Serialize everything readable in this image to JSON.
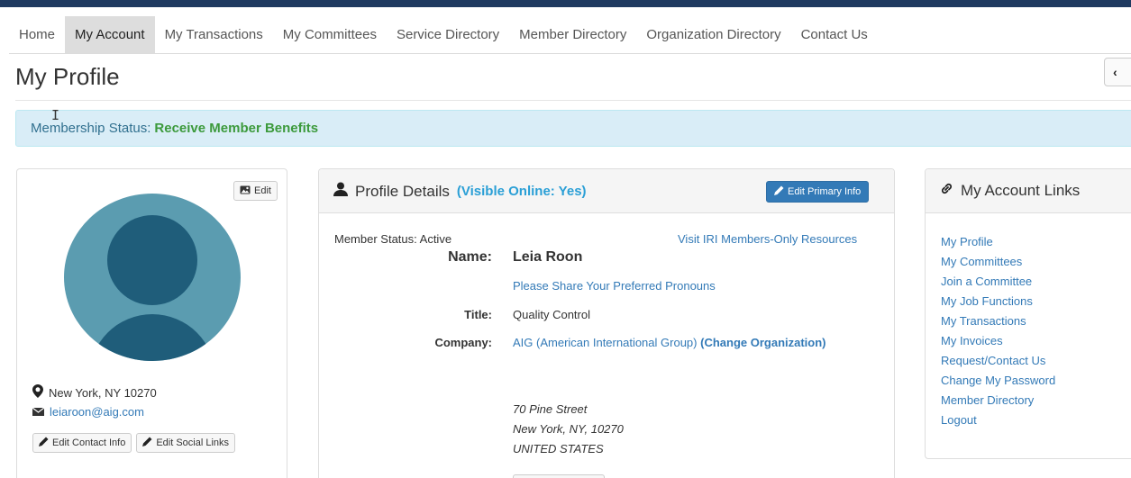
{
  "nav": {
    "items": [
      {
        "label": "Home",
        "active": false
      },
      {
        "label": "My Account",
        "active": true
      },
      {
        "label": "My Transactions",
        "active": false
      },
      {
        "label": "My Committees",
        "active": false
      },
      {
        "label": "Service Directory",
        "active": false
      },
      {
        "label": "Member Directory",
        "active": false
      },
      {
        "label": "Organization Directory",
        "active": false
      },
      {
        "label": "Contact Us",
        "active": false
      }
    ]
  },
  "page": {
    "title": "My Profile",
    "collapse_icon": "‹"
  },
  "alert": {
    "label": "Membership Status:",
    "value": "Receive Member Benefits"
  },
  "left_panel": {
    "edit_photo_label": "Edit",
    "location": "New York, NY 10270",
    "email": "leiaroon@aig.com",
    "edit_contact_label": "Edit Contact Info",
    "edit_social_label": "Edit Social Links"
  },
  "profile": {
    "heading": "Profile Details",
    "visibility": "(Visible Online: Yes)",
    "edit_primary_label": "Edit Primary Info",
    "member_status": "Member Status: Active",
    "resources_link": "Visit IRI Members-Only Resources",
    "name_label": "Name:",
    "name_value": "Leia Roon",
    "pronouns_link": "Please Share Your Preferred Pronouns",
    "title_label": "Title:",
    "title_value": "Quality Control",
    "company_label": "Company:",
    "company_value": "AIG (American International Group)",
    "change_org_link": "(Change Organization)",
    "address_line1": "70 Pine Street",
    "address_line2": "New York, NY, 10270",
    "address_line3": "UNITED STATES"
  },
  "account_links": {
    "heading": "My Account Links",
    "items": [
      "My Profile",
      "My Committees",
      "Join a Committee",
      "My Job Functions",
      "My Transactions",
      "My Invoices",
      "Request/Contact Us",
      "Change My Password",
      "Member Directory",
      "Logout"
    ]
  },
  "colors": {
    "accent": "#337ab7",
    "alert_bg": "#d9edf7",
    "status_green": "#3c9a3c",
    "avatar_bg": "#5b9cb0",
    "avatar_fg": "#1f5d7a"
  }
}
